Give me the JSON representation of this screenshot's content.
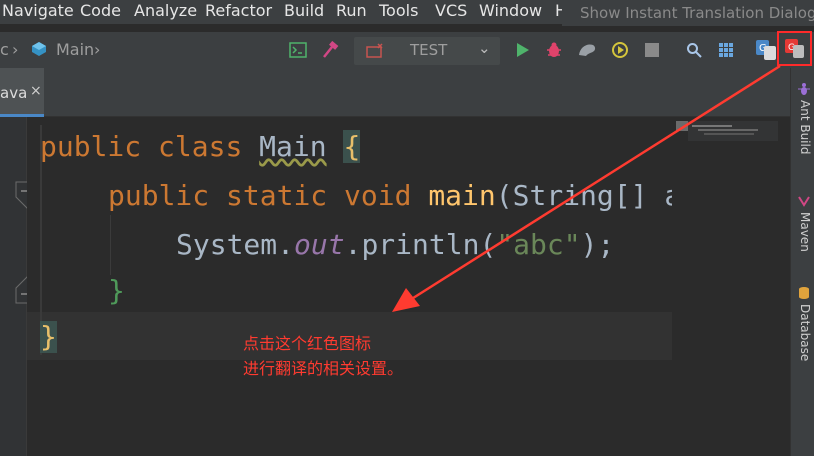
{
  "menu": {
    "items": [
      "Navigate",
      "Code",
      "Analyze",
      "Refactor",
      "Build",
      "Run",
      "Tools",
      "VCS",
      "Window",
      "Help"
    ]
  },
  "tooltip": {
    "text": "Show Instant Translation Dialog"
  },
  "navbar": {
    "crumb_prefix": "c",
    "crumb_file": "Main",
    "run_config": "TEST"
  },
  "tabs": [
    {
      "label": "ava",
      "close": "×"
    }
  ],
  "code": {
    "line1": [
      "public",
      " ",
      "class",
      " ",
      "Main",
      " ",
      "{"
    ],
    "line2": [
      "public",
      " ",
      "static",
      " ",
      "void",
      " ",
      "main",
      "(String[] a"
    ],
    "line3": [
      "System.",
      "out",
      ".println(",
      "\"abc\"",
      ");"
    ],
    "line4": "}",
    "line5": "}"
  },
  "sidebar": {
    "items": [
      {
        "label": "Ant Build",
        "icon": "ant-icon"
      },
      {
        "label": "Maven",
        "icon": "maven-icon"
      },
      {
        "label": "Database",
        "icon": "database-icon"
      }
    ]
  },
  "annotation": {
    "line1": "点击这个红色图标",
    "line2": "进行翻译的相关设置。"
  },
  "colors": {
    "annotation": "#ff3b30",
    "keyword": "#cc7832",
    "accent": "#4a88c7"
  }
}
